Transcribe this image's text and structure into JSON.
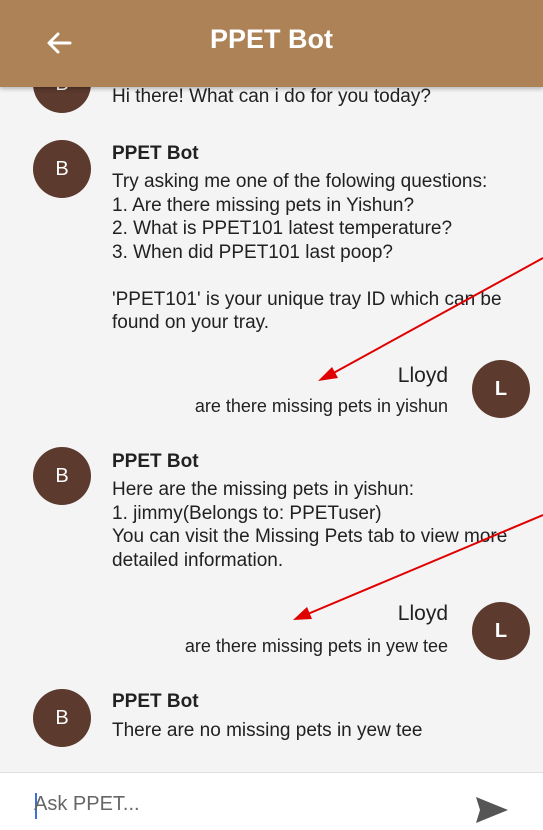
{
  "appbar": {
    "title": "PPET Bot",
    "back_icon": "arrow-left-icon"
  },
  "messages": [
    {
      "from": "bot",
      "avatar": "B",
      "sender": "",
      "text": "Hi there! What can i do for you today?"
    },
    {
      "from": "bot",
      "avatar": "B",
      "sender": "PPET Bot",
      "text": "Try asking me one of the folowing questions:\n1. Are there missing pets in Yishun?\n2. What is PPET101 latest temperature?\n3. When did PPET101 last poop?\n\n'PPET101' is your unique tray ID which can be found on your tray."
    },
    {
      "from": "user",
      "avatar": "L",
      "sender": "Lloyd",
      "text": "are there missing pets in yishun"
    },
    {
      "from": "bot",
      "avatar": "B",
      "sender": "PPET Bot",
      "text": "Here are the missing pets in yishun:\n1. jimmy(Belongs to: PPETuser)\nYou can visit the Missing Pets tab to view more detailed information."
    },
    {
      "from": "user",
      "avatar": "L",
      "sender": "Lloyd",
      "text": "are there missing pets in yew tee"
    },
    {
      "from": "bot",
      "avatar": "B",
      "sender": "PPET Bot",
      "text": "There are no missing pets in yew tee"
    }
  ],
  "input": {
    "placeholder": "Ask PPET...",
    "value": ""
  },
  "send_icon": "send-icon",
  "colors": {
    "appbar": "#ad8257",
    "avatar": "#5c3a2e",
    "chat_bg": "#f4f4f4",
    "annotation_arrow": "#e00000"
  }
}
